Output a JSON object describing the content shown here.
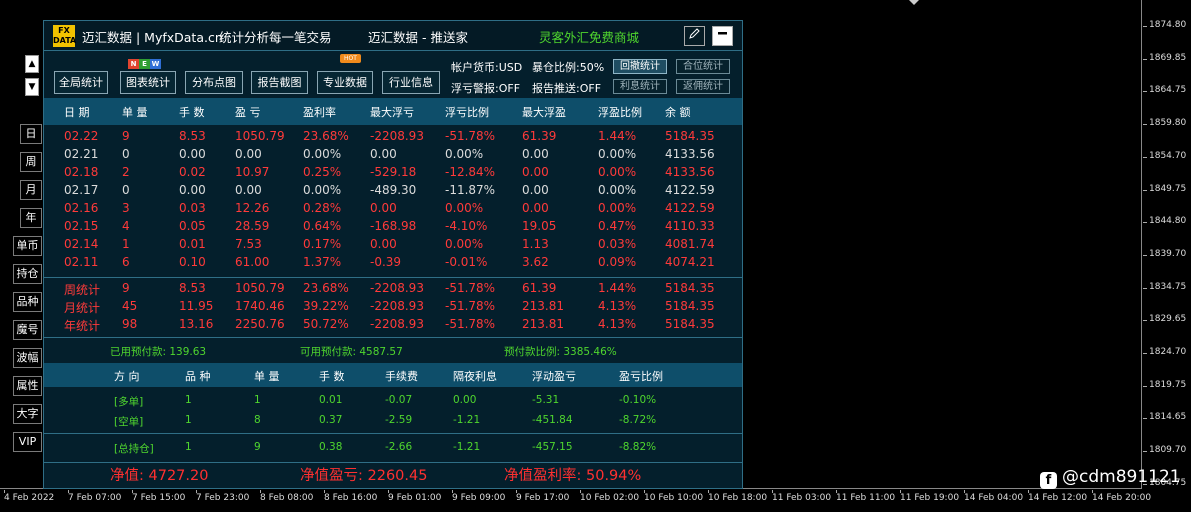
{
  "panel": {
    "title_left": "迈汇数据 | MyfxData.cn",
    "title_slogan": "统计分析每一笔交易",
    "title_center": "迈汇数据 - 推送家",
    "title_right": "灵客外汇免费商城",
    "edit_icon": "pen-icon",
    "minimize_icon": "minus-icon",
    "logo_top": "FX",
    "logo_bottom": "DATA"
  },
  "nav": {
    "up": "▲",
    "down": "▼",
    "period": [
      "日",
      "周",
      "月",
      "年"
    ],
    "views": [
      "单币",
      "持仓",
      "品种",
      "魔号",
      "波幅",
      "属性",
      "大字",
      "VIP"
    ]
  },
  "toolbar": {
    "buttons": [
      "全局统计",
      "图表统计",
      "分布点图",
      "报告截图",
      "专业数据",
      "行业信息"
    ],
    "new_badge": [
      "N",
      "E",
      "W"
    ],
    "hot_badge": "HOT",
    "account_currency": "帐户货币:USD",
    "exposure": "暴仓比例:50%",
    "float_loss_alert": "浮亏警报:OFF",
    "report_push": "报告推送:OFF",
    "mini_buttons": [
      "回撤统计",
      "合位统计",
      "利息统计",
      "返佣统计"
    ]
  },
  "daily_table": {
    "headers": [
      "日 期",
      "单 量",
      "手 数",
      "盈 亏",
      "盈利率",
      "最大浮亏",
      "浮亏比例",
      "最大浮盈",
      "浮盈比例",
      "余 额"
    ],
    "rows": [
      {
        "color": "red",
        "cells": [
          "02.22",
          "9",
          "8.53",
          "1050.79",
          "23.68%",
          "-2208.93",
          "-51.78%",
          "61.39",
          "1.44%",
          "5184.35"
        ]
      },
      {
        "color": "white",
        "cells": [
          "02.21",
          "0",
          "0.00",
          "0.00",
          "0.00%",
          "0.00",
          "0.00%",
          "0.00",
          "0.00%",
          "4133.56"
        ]
      },
      {
        "color": "red",
        "cells": [
          "02.18",
          "2",
          "0.02",
          "10.97",
          "0.25%",
          "-529.18",
          "-12.84%",
          "0.00",
          "0.00%",
          "4133.56"
        ]
      },
      {
        "color": "white",
        "cells": [
          "02.17",
          "0",
          "0.00",
          "0.00",
          "0.00%",
          "-489.30",
          "-11.87%",
          "0.00",
          "0.00%",
          "4122.59"
        ]
      },
      {
        "color": "red",
        "cells": [
          "02.16",
          "3",
          "0.03",
          "12.26",
          "0.28%",
          "0.00",
          "0.00%",
          "0.00",
          "0.00%",
          "4122.59"
        ]
      },
      {
        "color": "red",
        "cells": [
          "02.15",
          "4",
          "0.05",
          "28.59",
          "0.64%",
          "-168.98",
          "-4.10%",
          "19.05",
          "0.47%",
          "4110.33"
        ]
      },
      {
        "color": "red",
        "cells": [
          "02.14",
          "1",
          "0.01",
          "7.53",
          "0.17%",
          "0.00",
          "0.00%",
          "1.13",
          "0.03%",
          "4081.74"
        ]
      },
      {
        "color": "red",
        "cells": [
          "02.11",
          "6",
          "0.10",
          "61.00",
          "1.37%",
          "-0.39",
          "-0.01%",
          "3.62",
          "0.09%",
          "4074.21"
        ]
      }
    ]
  },
  "summary_rows": [
    {
      "cells": [
        "周统计",
        "9",
        "8.53",
        "1050.79",
        "23.68%",
        "-2208.93",
        "-51.78%",
        "61.39",
        "1.44%",
        "5184.35"
      ]
    },
    {
      "cells": [
        "月统计",
        "45",
        "11.95",
        "1740.46",
        "39.22%",
        "-2208.93",
        "-51.78%",
        "213.81",
        "4.13%",
        "5184.35"
      ]
    },
    {
      "cells": [
        "年统计",
        "98",
        "13.16",
        "2250.76",
        "50.72%",
        "-2208.93",
        "-51.78%",
        "213.81",
        "4.13%",
        "5184.35"
      ]
    }
  ],
  "margin": {
    "used": "已用预付款: 139.63",
    "available": "可用预付款: 4587.57",
    "ratio": "预付款比例: 3385.46%"
  },
  "positions": {
    "headers": [
      "方 向",
      "品 种",
      "单 量",
      "手 数",
      "手续费",
      "隔夜利息",
      "浮动盈亏",
      "盈亏比例"
    ],
    "rows": [
      [
        "[多单]",
        "1",
        "1",
        "0.01",
        "-0.07",
        "0.00",
        "-5.31",
        "-0.10%"
      ],
      [
        "[空单]",
        "1",
        "8",
        "0.37",
        "-2.59",
        "-1.21",
        "-451.84",
        "-8.72%"
      ]
    ],
    "total": [
      "[总持仓]",
      "1",
      "9",
      "0.38",
      "-2.66",
      "-1.21",
      "-457.15",
      "-8.82%"
    ]
  },
  "totals": {
    "equity": "净值: 4727.20",
    "equity_pnl": "净值盈亏: 2260.45",
    "equity_rate": "净值盈利率: 50.94%"
  },
  "price_axis": [
    "1874.80",
    "1869.85",
    "1864.75",
    "1859.80",
    "1854.70",
    "1849.75",
    "1844.80",
    "1839.70",
    "1834.75",
    "1829.65",
    "1824.70",
    "1819.75",
    "1814.65",
    "1809.70",
    "1804.75"
  ],
  "time_axis": [
    "4 Feb 2022",
    "7 Feb 07:00",
    "7 Feb 15:00",
    "7 Feb 23:00",
    "8 Feb 08:00",
    "8 Feb 16:00",
    "9 Feb 01:00",
    "9 Feb 09:00",
    "9 Feb 17:00",
    "10 Feb 02:00",
    "10 Feb 10:00",
    "10 Feb 18:00",
    "11 Feb 03:00",
    "11 Feb 11:00",
    "11 Feb 19:00",
    "14 Feb 04:00",
    "14 Feb 12:00",
    "14 Feb 20:00"
  ],
  "watermark": {
    "icon": "facebook-icon",
    "icon_glyph": "f",
    "text": "@cdm891121"
  }
}
